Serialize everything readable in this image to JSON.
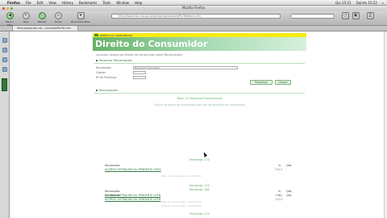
{
  "menubar": {
    "apple": "",
    "items": [
      "Firefox",
      "File",
      "Edit",
      "View",
      "History",
      "Bookmarks",
      "Tools",
      "Window",
      "Help"
    ],
    "clock": "Qui 15:21",
    "user": "Quinta 15:22"
  },
  "window": {
    "title": "Mozilla Firefox",
    "toolbar": {
      "buttons": [
        {
          "label": "Back / Fwd",
          "icon": "back-arrow-icon"
        },
        {
          "label": "Stop",
          "icon": "stop-icon"
        },
        {
          "label": "Reload",
          "icon": "reload-icon"
        },
        {
          "label": "Home",
          "icon": "home-icon"
        },
        {
          "label": "Bookmark Sites",
          "icon": "bookmark-icon"
        }
      ],
      "url": "http://www.dsc.ms.gov.br/pesquisa/consultaPorTelefone.cfm",
      "right_buttons": [
        {
          "label": "History",
          "icon": "history-icon"
        },
        {
          "label": "Downloads",
          "icon": "downloads-icon"
        },
        {
          "label": "Screenshot Viewer",
          "icon": "screenshot-icon"
        },
        {
          "label": "Print",
          "icon": "print-icon"
        }
      ]
    },
    "tab_title": "http://www.dsc.ms...ConsultaPorTel.cfm"
  },
  "page": {
    "brand_bar_text": "DIREITO DO CONSUMIDOR",
    "banner_title": "Direito do Consumidor",
    "subtitle": "Consulta: Acesso ao Direito de Consumidor sobre Reclamações",
    "section_search": "Pesquisar Reclamações",
    "fields": [
      {
        "label": "Reclamado:",
        "value": "Nome do Fornecedor",
        "width_class": "wide"
      },
      {
        "label": "Cidade:",
        "value": "",
        "width_class": "short"
      },
      {
        "label": "Nº do Processo:",
        "value": "",
        "width_class": "short"
      },
      {
        "label": "",
        "value": "",
        "width_class": "short"
      }
    ],
    "btn_search": "Pesquisar",
    "btn_clear": "Limpar",
    "section_results": "Reclamações",
    "results_summary": "Total: 10 Registros Encontrados",
    "results_hint": "Clique no nome do reclamado para ver os detalhes da reclamação",
    "records": [
      {
        "status": "Pendente: 170",
        "label": "Reclamado:",
        "link": "ACORDO EXTRAJUDICIAL PENDENTE VISTA",
        "num": "250,0",
        "right_label": "Qtd:",
        "pct": "%",
        "date": "Data da reclamação: 01/05/2009"
      },
      {
        "status": "Pendente: 180",
        "label": "Reclamado:",
        "link": "ACORDO EXTRAJUDICIAL PENDENTE LDTN",
        "num": "125,8",
        "right_label": "Qtd:",
        "pct": "%",
        "date": "Data da reclamação: 07/05/2009"
      },
      {
        "status": "Pendente: 170",
        "label": "Reclamado:",
        "link": "ACORDO EXTRAJUDICIAL PENDENTE LDTN",
        "num": "250,0",
        "right_label": "Qtd:",
        "pct": "%",
        "date": "Data da reclamação: 11/05/2009"
      },
      {
        "status": "Pendente: 175",
        "label": "",
        "link": "",
        "num": "",
        "right_label": "",
        "pct": "",
        "date": ""
      }
    ]
  }
}
